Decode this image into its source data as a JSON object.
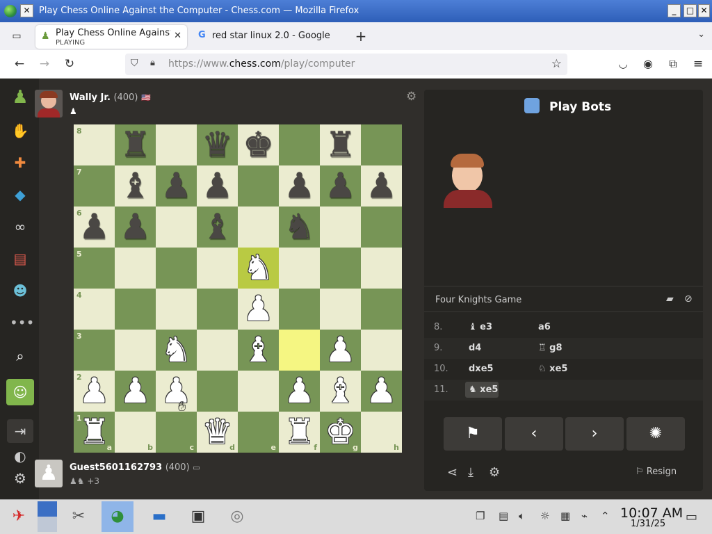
{
  "window": {
    "title": "Play Chess Online Against the Computer - Chess.com — Mozilla Firefox"
  },
  "tabs": [
    {
      "title": "Play Chess Online Against",
      "subtitle": "PLAYING",
      "close": "✕"
    },
    {
      "title": "red star linux 2.0 - Google",
      "close": "✕"
    }
  ],
  "newtab": "+",
  "url": {
    "prefix": "https://www.",
    "domain": "chess.com",
    "path": "/play/computer"
  },
  "top_player": {
    "name": "Wally Jr.",
    "rating": "(400)",
    "flag": "🇺🇸",
    "captured": "♟"
  },
  "bottom_player": {
    "name": "Guest5601162793",
    "rating": "(400)",
    "flag": "▭",
    "captured": "♟♞",
    "extra": "+3"
  },
  "board": {
    "ranks": [
      "8",
      "7",
      "6",
      "5",
      "4",
      "3",
      "2",
      "1"
    ],
    "files": [
      "a",
      "b",
      "c",
      "d",
      "e",
      "f",
      "g",
      "h"
    ],
    "highlight": [
      "e5",
      "f3"
    ],
    "pieces": [
      {
        "sq": "b8",
        "p": "♜",
        "c": "b"
      },
      {
        "sq": "d8",
        "p": "♛",
        "c": "b"
      },
      {
        "sq": "e8",
        "p": "♚",
        "c": "b"
      },
      {
        "sq": "g8",
        "p": "♜",
        "c": "b"
      },
      {
        "sq": "b7",
        "p": "♝",
        "c": "b"
      },
      {
        "sq": "c7",
        "p": "♟",
        "c": "b"
      },
      {
        "sq": "d7",
        "p": "♟",
        "c": "b"
      },
      {
        "sq": "f7",
        "p": "♟",
        "c": "b"
      },
      {
        "sq": "g7",
        "p": "♟",
        "c": "b"
      },
      {
        "sq": "h7",
        "p": "♟",
        "c": "b"
      },
      {
        "sq": "a6",
        "p": "♟",
        "c": "b"
      },
      {
        "sq": "b6",
        "p": "♟",
        "c": "b"
      },
      {
        "sq": "d6",
        "p": "♝",
        "c": "b"
      },
      {
        "sq": "f6",
        "p": "♞",
        "c": "b"
      },
      {
        "sq": "e5",
        "p": "♞",
        "c": "w"
      },
      {
        "sq": "e4",
        "p": "♟",
        "c": "w"
      },
      {
        "sq": "c3",
        "p": "♞",
        "c": "w"
      },
      {
        "sq": "e3",
        "p": "♝",
        "c": "w"
      },
      {
        "sq": "g3",
        "p": "♟",
        "c": "w"
      },
      {
        "sq": "a2",
        "p": "♟",
        "c": "w"
      },
      {
        "sq": "b2",
        "p": "♟",
        "c": "w"
      },
      {
        "sq": "c2",
        "p": "♟",
        "c": "w"
      },
      {
        "sq": "f2",
        "p": "♟",
        "c": "w"
      },
      {
        "sq": "g2",
        "p": "♝",
        "c": "w"
      },
      {
        "sq": "h2",
        "p": "♟",
        "c": "w"
      },
      {
        "sq": "a1",
        "p": "♜",
        "c": "w"
      },
      {
        "sq": "d1",
        "p": "♛",
        "c": "w"
      },
      {
        "sq": "f1",
        "p": "♜",
        "c": "w"
      },
      {
        "sq": "g1",
        "p": "♚",
        "c": "w"
      }
    ]
  },
  "panel": {
    "title": "Play Bots",
    "opening": "Four Knights Game",
    "moves": [
      {
        "n": "8.",
        "w": "♝ e3",
        "b": "a6"
      },
      {
        "n": "9.",
        "w": "d4",
        "b": "♖ g8"
      },
      {
        "n": "10.",
        "w": "dxe5",
        "b": "♘ xe5"
      },
      {
        "n": "11.",
        "w": "♞ xe5",
        "b": ""
      }
    ],
    "resign": "Resign"
  },
  "clock": {
    "time": "10:07 AM",
    "date": "1/31/25"
  },
  "colors": {
    "light_square": "#ebecd0",
    "dark_square": "#779556",
    "highlight": "#f5f682",
    "background": "#302e2b"
  }
}
